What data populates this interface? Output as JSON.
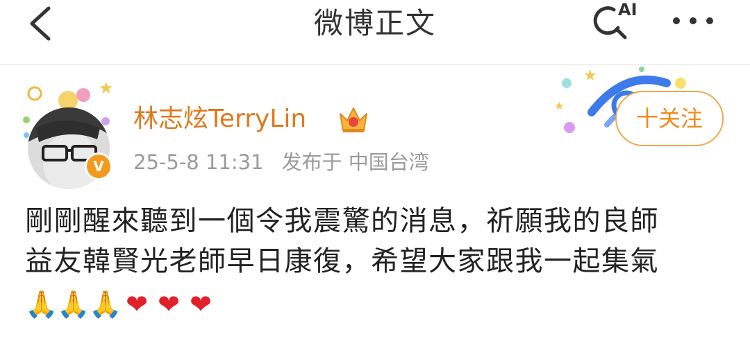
{
  "nav": {
    "title": "微博正文",
    "ai_label": "AI"
  },
  "post": {
    "author": "林志炫TerryLin",
    "timestamp": "25-5-8 11:31",
    "published_at": "发布于 中国台湾",
    "follow_label": "十关注",
    "text_line1": "剛剛醒來聽到一個令我震驚的消息，祈願我的良師",
    "text_line2": "益友韓賢光老師早日康復，希望大家跟我一起集氣",
    "emojis": [
      "🙏",
      "🙏",
      "🙏",
      "❤",
      "❤",
      "❤"
    ]
  },
  "colors": {
    "accent_orange": "#e0781c",
    "vip_badge": "#f29a1b",
    "meta_gray": "#9a9a9a"
  }
}
